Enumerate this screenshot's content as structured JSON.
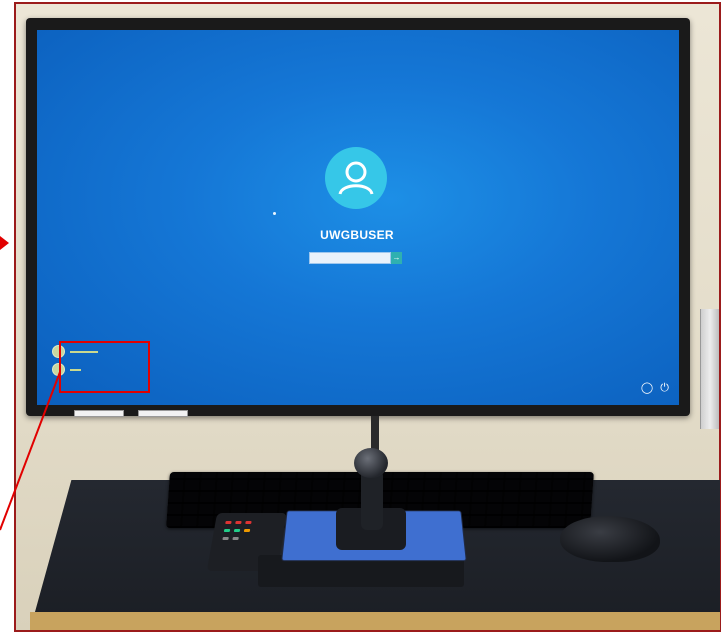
{
  "login_screen": {
    "username": "UWGBUSER",
    "password_placeholder": "",
    "submit_arrow": "→",
    "avatar_icon": "user-icon",
    "system_icons": [
      "accessibility-icon",
      "power-icon"
    ]
  },
  "accounts_panel": {
    "items": [
      {
        "icon": "account-icon",
        "label": ""
      },
      {
        "icon": "account-icon",
        "label": ""
      }
    ]
  },
  "annotation": {
    "highlight_color": "#e10000",
    "frame_color": "#9b1b1b"
  },
  "colors": {
    "screen_blue": "#1577d6",
    "avatar": "#36c7e8",
    "joystick_base": "#3f6fd0",
    "table_edge": "#c8a35e"
  }
}
